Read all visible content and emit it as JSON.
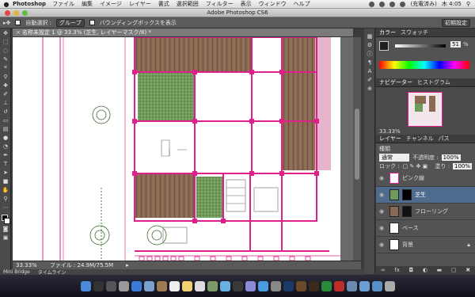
{
  "menubar": {
    "app_name": "Photoshop",
    "items": [
      "ファイル",
      "編集",
      "イメージ",
      "レイヤー",
      "書式",
      "選択範囲",
      "フィルター",
      "表示",
      "ウィンドウ",
      "ヘルプ"
    ],
    "battery": "(充電済み)",
    "clock": "木 4:05"
  },
  "window": {
    "title": "Adobe Photoshop CS6"
  },
  "options": {
    "auto_select_label": "自動選択 :",
    "group_value": "グループ",
    "bbox_label": "バウンディングボックスを表示",
    "workspace": "初期設定"
  },
  "document": {
    "tab_title": "名称未設定 1 @ 33.3% (芝生, レイヤーマスク/8) *",
    "zoom": "33.33%",
    "file_info": "ファイル : 24.9M/75.5M"
  },
  "panels": {
    "color_tab": "カラー",
    "swatch_tab": "スウォッチ",
    "k_value": "51",
    "k_unit": "%",
    "navigator_tab": "ナビゲーター",
    "histogram_tab": "ヒストグラム",
    "nav_zoom": "33.33%",
    "layers_tab": "レイヤー",
    "channels_tab": "チャンネル",
    "paths_tab": "パス",
    "kind_label": "種類",
    "blend_mode": "通常",
    "opacity_label": "不透明度 :",
    "opacity_value": "100%",
    "lock_label": "ロック :",
    "fill_label": "塗り :",
    "fill_value": "100%",
    "layers": [
      {
        "name": "ピンク線"
      },
      {
        "name": "芝生"
      },
      {
        "name": "フローリング"
      },
      {
        "name": "ベース"
      },
      {
        "name": "背景"
      }
    ]
  },
  "bottom": {
    "tab1": "Mini Bridge",
    "tab2": "タイムライン"
  }
}
